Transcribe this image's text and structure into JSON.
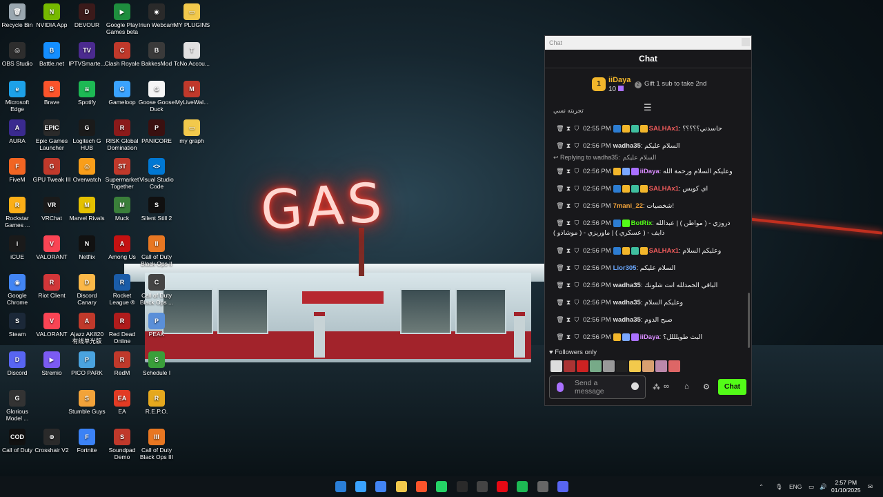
{
  "desktop_icons": [
    {
      "label": "Recycle Bin",
      "color": "#9aa7b0",
      "glyph": "🗑"
    },
    {
      "label": "NVIDIA App",
      "color": "#76b900",
      "glyph": "N"
    },
    {
      "label": "DEVOUR",
      "color": "#3b1a1a",
      "glyph": "D"
    },
    {
      "label": "Google Play Games beta",
      "color": "#1e8e3e",
      "glyph": "▶"
    },
    {
      "label": "Iriun Webcam",
      "color": "#2a2a2a",
      "glyph": "◉"
    },
    {
      "label": "MY PLUGINS",
      "color": "#f2c94c",
      "glyph": "▭"
    },
    {
      "label": "OBS Studio",
      "color": "#2d2d2d",
      "glyph": "◎"
    },
    {
      "label": "Battle.net",
      "color": "#148eff",
      "glyph": "B"
    },
    {
      "label": "IPTVSmarte...",
      "color": "#4b2a8f",
      "glyph": "TV"
    },
    {
      "label": "Clash Royale",
      "color": "#c0392b",
      "glyph": "C"
    },
    {
      "label": "BakkesMod",
      "color": "#3a3a3a",
      "glyph": "B"
    },
    {
      "label": "TcNo Accou...",
      "color": "#e0e0e0",
      "glyph": "T"
    },
    {
      "label": "Microsoft Edge",
      "color": "#1da1e8",
      "glyph": "e"
    },
    {
      "label": "Brave",
      "color": "#fb542b",
      "glyph": "B"
    },
    {
      "label": "Spotify",
      "color": "#1db954",
      "glyph": "≋"
    },
    {
      "label": "Gameloop",
      "color": "#3aa3ff",
      "glyph": "G"
    },
    {
      "label": "Goose Goose Duck",
      "color": "#f5f5f5",
      "glyph": "G"
    },
    {
      "label": "MyLiveWal...",
      "color": "#c0392b",
      "glyph": "M"
    },
    {
      "label": "AURA",
      "color": "#3a2a8f",
      "glyph": "A"
    },
    {
      "label": "Epic Games Launcher",
      "color": "#2a2a2a",
      "glyph": "EPIC"
    },
    {
      "label": "Logitech G HUB",
      "color": "#1a1a1a",
      "glyph": "G"
    },
    {
      "label": "RISK Global Domination",
      "color": "#8b1a1a",
      "glyph": "R"
    },
    {
      "label": "PANICORE",
      "color": "#3a1010",
      "glyph": "P"
    },
    {
      "label": "my graph",
      "color": "#f2c94c",
      "glyph": "▭"
    },
    {
      "label": "FiveM",
      "color": "#f26522",
      "glyph": "F"
    },
    {
      "label": "GPU Tweak III",
      "color": "#c0392b",
      "glyph": "G"
    },
    {
      "label": "Overwatch",
      "color": "#f99e1a",
      "glyph": "◎"
    },
    {
      "label": "Supermarket Together",
      "color": "#c0392b",
      "glyph": "ST"
    },
    {
      "label": "Visual Studio Code",
      "color": "#0078d4",
      "glyph": "<>"
    },
    {
      "label": "Rockstar Games ...",
      "color": "#fcaf17",
      "glyph": "R"
    },
    {
      "label": "VRChat",
      "color": "#1a1a1a",
      "glyph": "VR"
    },
    {
      "label": "Marvel Rivals",
      "color": "#e5c100",
      "glyph": "M"
    },
    {
      "label": "Muck",
      "color": "#3a7f3a",
      "glyph": "M"
    },
    {
      "label": "Silent Still 2",
      "color": "#101010",
      "glyph": "S"
    },
    {
      "label": "iCUE",
      "color": "#1a1a1a",
      "glyph": "i"
    },
    {
      "label": "VALORANT",
      "color": "#fa4454",
      "glyph": "V"
    },
    {
      "label": "Netflix",
      "color": "#111",
      "glyph": "N"
    },
    {
      "label": "Among Us",
      "color": "#c51111",
      "glyph": "A"
    },
    {
      "label": "Call of Duty Black Ops II",
      "color": "#e87722",
      "glyph": "II"
    },
    {
      "label": "Google Chrome",
      "color": "#4285f4",
      "glyph": "◉"
    },
    {
      "label": "Riot Client",
      "color": "#d13639",
      "glyph": "R"
    },
    {
      "label": "Discord Canary",
      "color": "#fbb848",
      "glyph": "D"
    },
    {
      "label": "Rocket League ®",
      "color": "#1a5ca8",
      "glyph": "R"
    },
    {
      "label": "Call of Duty Black Ops ...",
      "color": "#444",
      "glyph": "C"
    },
    {
      "label": "Steam",
      "color": "#1b2838",
      "glyph": "S"
    },
    {
      "label": "VALORANT",
      "color": "#fa4454",
      "glyph": "V"
    },
    {
      "label": "Ajazz AK820 有线单光版",
      "color": "#c0392b",
      "glyph": "A"
    },
    {
      "label": "Red Dead Online",
      "color": "#b01c1c",
      "glyph": "R"
    },
    {
      "label": "PEAK",
      "color": "#5a8fd8",
      "glyph": "P"
    },
    {
      "label": "Discord",
      "color": "#5865f2",
      "glyph": "D"
    },
    {
      "label": "Stremio",
      "color": "#7b5bf2",
      "glyph": "▶"
    },
    {
      "label": "PICO PARK",
      "color": "#4aa3df",
      "glyph": "P"
    },
    {
      "label": "RedM",
      "color": "#c0392b",
      "glyph": "R"
    },
    {
      "label": "Schedule I",
      "color": "#3a9f3a",
      "glyph": "S"
    },
    {
      "label": "Glorious Model ...",
      "color": "#333",
      "glyph": "G"
    },
    {
      "label": "Stumble Guys",
      "color": "#f2a33a",
      "glyph": "S"
    },
    {
      "label": "EA",
      "color": "#e23b24",
      "glyph": "EA"
    },
    {
      "label": "R.E.P.O.",
      "color": "#e5a81e",
      "glyph": "R"
    },
    {
      "label": "Call of Duty",
      "color": "#111",
      "glyph": "COD"
    },
    {
      "label": "Crosshair V2",
      "color": "#2a2a2a",
      "glyph": "⊕"
    },
    {
      "label": "Fortnite",
      "color": "#3b82f6",
      "glyph": "F"
    },
    {
      "label": "Soundpad Demo",
      "color": "#c0392b",
      "glyph": "S"
    },
    {
      "label": "Call of Duty Black Ops III",
      "color": "#e87722",
      "glyph": "III"
    }
  ],
  "wallpaper": {
    "neon_sign": "GAS"
  },
  "chat": {
    "window_title": "Chat",
    "header": "Chat",
    "gift": {
      "rank": "1",
      "username": "iiDaya",
      "count": "10",
      "cta": "Gift 1 sub to take 2nd",
      "cta_icon": "2"
    },
    "cutoff_text": "تجربته نسي",
    "reply_label": "Replying to wadha35:",
    "reply_quote": "السلام عليكم",
    "messages": [
      {
        "time": "02:55 PM",
        "user": "SALHAx1",
        "color": "#f25c5c",
        "text": "حاسدني؟؟؟؟؟",
        "badges": [
          "#2d7dd2",
          "#f2b62b",
          "#3fbf9f",
          "#f2b62b"
        ]
      },
      {
        "time": "02:56 PM",
        "user": "wadha35",
        "color": "#e0e0e0",
        "text": "السلام عليكم",
        "badges": []
      },
      {
        "time": "02:56 PM",
        "user": "iiDaya",
        "color": "#d98cff",
        "text": "وعليكم السلام ورحمة الله",
        "badges": [
          "#f2b62b",
          "#7aa7ff",
          "#a970ff"
        ]
      },
      {
        "time": "02:56 PM",
        "user": "SALHAx1",
        "color": "#f25c5c",
        "text": "اي كويس",
        "badges": [
          "#2d7dd2",
          "#f2b62b",
          "#3fbf9f",
          "#f2b62b"
        ]
      },
      {
        "time": "02:56 PM",
        "user": "7mani_22",
        "color": "#f2a33a",
        "text": "شخصيات!",
        "badges": []
      },
      {
        "time": "02:56 PM",
        "user": "BotRix",
        "color": "#53fc18",
        "text": "دروزي - ( مواطن ) | عبدالله",
        "text2": "ذايف - ( عسكري ) | ماوريزي - ( موشاذو )",
        "badges": [
          "#2d7dd2",
          "#53fc18"
        ]
      },
      {
        "time": "02:56 PM",
        "user": "SALHAx1",
        "color": "#f25c5c",
        "text": "وعليكم السلام",
        "badges": [
          "#2d7dd2",
          "#f2b62b",
          "#3fbf9f",
          "#f2b62b"
        ]
      },
      {
        "time": "02:56 PM",
        "user": "Lior305",
        "color": "#6aa8ff",
        "text": "السلام عليكم",
        "badges": []
      },
      {
        "time": "02:56 PM",
        "user": "wadha35",
        "color": "#e0e0e0",
        "text": "الباقي الحمدلله انت شلونك",
        "badges": []
      },
      {
        "time": "02:56 PM",
        "user": "wadha35",
        "color": "#e0e0e0",
        "text": "وعليكم السلام",
        "badges": []
      },
      {
        "time": "02:56 PM",
        "user": "wadha35",
        "color": "#e0e0e0",
        "text": "صبح الدوم",
        "badges": []
      },
      {
        "time": "02:56 PM",
        "user": "iiDaya",
        "color": "#d98cff",
        "text": "البث طويلللل؟",
        "badges": [
          "#f2b62b",
          "#7aa7ff",
          "#a970ff"
        ]
      }
    ],
    "followers_only": "Followers only",
    "emotes": [
      "#ddd",
      "#a33",
      "#c22",
      "#7a8",
      "#999",
      "#222",
      "#f2c94c",
      "#d8a070",
      "#b8a",
      "#d66"
    ],
    "input_placeholder": "Send a message",
    "chat_button": "Chat"
  },
  "taskbar": {
    "apps": [
      "#3aa3ff",
      "#4285f4",
      "#f2c94c",
      "#fb542b",
      "#25d366",
      "#2a2a2a",
      "#444",
      "#e50914",
      "#1db954",
      "#666",
      "#5865f2"
    ],
    "lang": "ENG",
    "time": "2:57 PM",
    "date": "01/10/2025"
  }
}
